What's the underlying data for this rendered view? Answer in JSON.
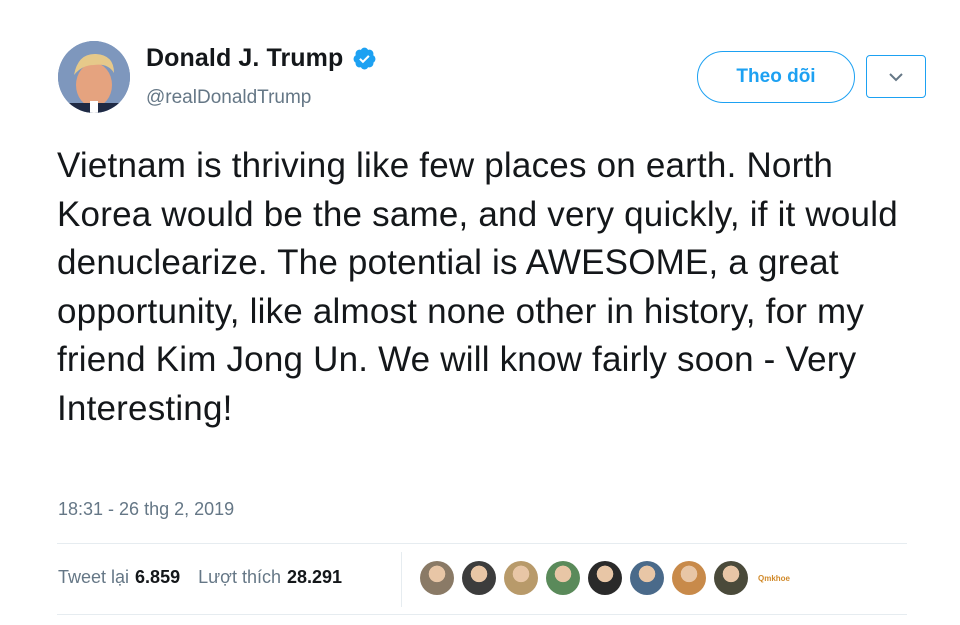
{
  "user": {
    "name": "Donald J. Trump",
    "handle": "@realDonaldTrump",
    "avatar_icon": "profile-photo"
  },
  "actions": {
    "follow_label": "Theo dõi",
    "more_icon": "chevron-down-icon"
  },
  "tweet": {
    "text": "Vietnam is thriving like few places on earth. North Korea would be the same, and very quickly, if it would denuclearize. The potential is AWESOME, a great opportunity, like almost none other in history, for my friend Kim Jong Un. We will know fairly soon - Very Interesting!",
    "timestamp": "18:31 - 26 thg 2, 2019"
  },
  "stats": {
    "retweets_label": "Tweet lại",
    "retweets_value": "6.859",
    "likes_label": "Lượt thích",
    "likes_value": "28.291"
  },
  "likers": [
    {
      "color": "#8a7a66"
    },
    {
      "color": "#3c3c3c"
    },
    {
      "color": "#b89a6a"
    },
    {
      "color": "#5a8a5a"
    },
    {
      "color": "#2a2a2a"
    },
    {
      "color": "#4a6a8a"
    },
    {
      "color": "#c88a4a"
    },
    {
      "color": "#4a4a3a"
    }
  ],
  "watermark": "Qmkhoe",
  "colors": {
    "accent": "#1da1f2",
    "text": "#14171a",
    "muted": "#657786"
  }
}
